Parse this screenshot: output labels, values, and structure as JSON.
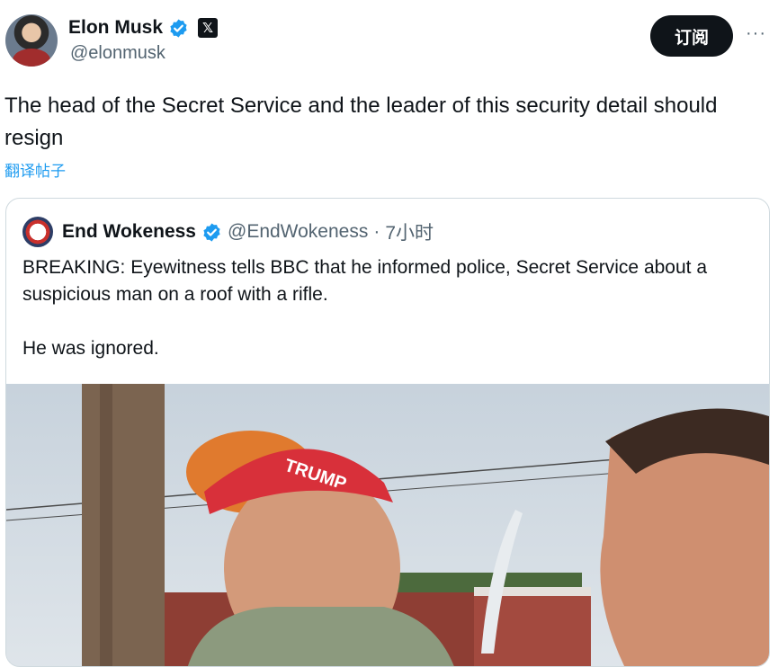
{
  "author": {
    "name": "Elon Musk",
    "handle": "@elonmusk"
  },
  "header": {
    "subscribe_label": "订阅",
    "more_label": "···"
  },
  "post": {
    "text": "The head of the Secret Service and the leader of this security detail should resign",
    "translate_label": "翻译帖子"
  },
  "quoted": {
    "name": "End Wokeness",
    "handle": "@EndWokeness",
    "separator": "·",
    "time": "7小时",
    "text_line1": "BREAKING: Eyewitness tells BBC that he informed police, Secret Service about a suspicious man on a roof with a rifle.",
    "text_line2": "He was ignored.",
    "media": {
      "cap_text": "TRUMP"
    }
  },
  "colors": {
    "accent": "#1d9bf0",
    "text": "#0f1419",
    "secondary": "#536471",
    "border": "#cfd9de"
  }
}
